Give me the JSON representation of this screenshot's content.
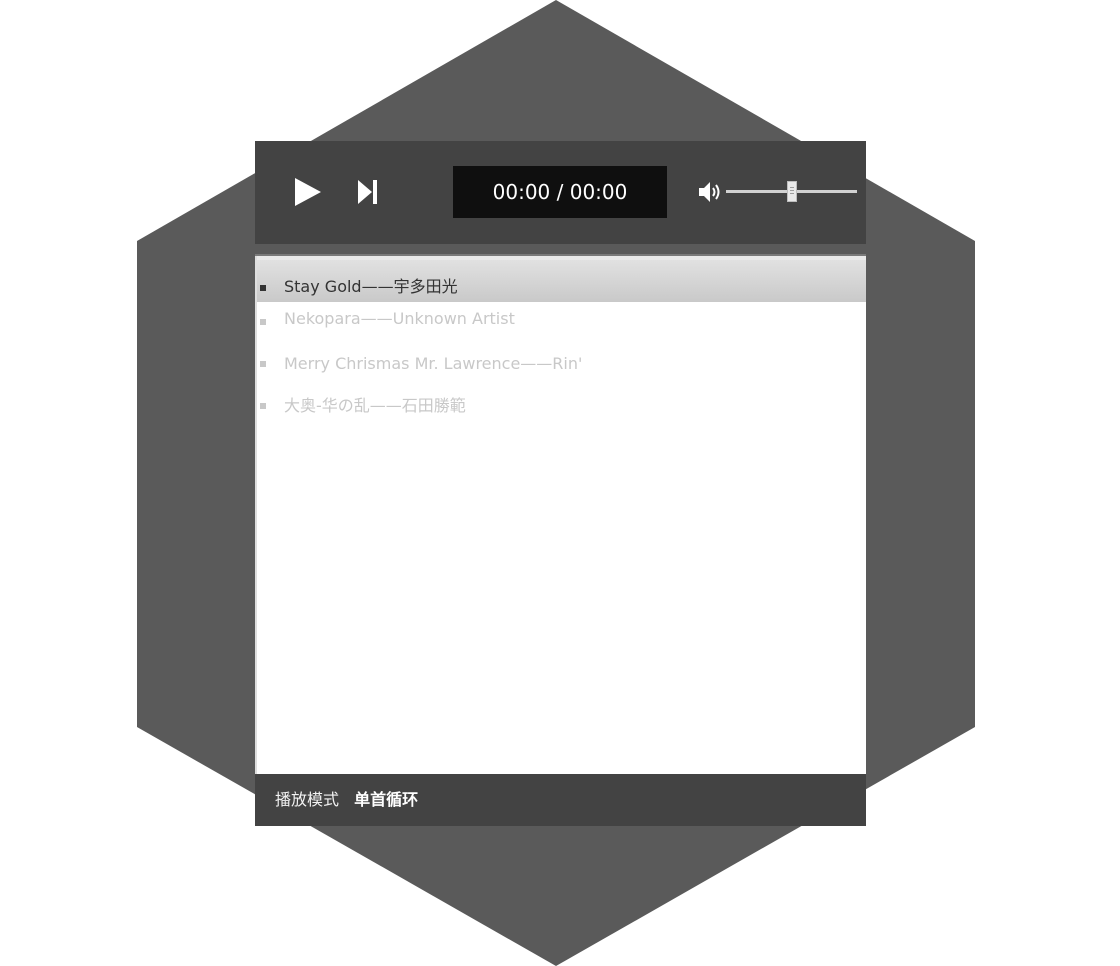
{
  "player": {
    "time_display": "00:00 / 00:00",
    "volume": 0.5,
    "icons": {
      "play": "play-icon",
      "next": "skip-next-icon",
      "volume": "speaker-volume-icon"
    }
  },
  "playlist": {
    "tracks": [
      {
        "label": "Stay Gold——宇多田光",
        "active": true
      },
      {
        "label": "Nekopara——Unknown Artist",
        "active": false
      },
      {
        "label": "Merry Chrismas Mr. Lawrence——Rin'",
        "active": false
      },
      {
        "label": "大奥-华の乱——石田勝範",
        "active": false
      }
    ]
  },
  "footer": {
    "mode_label": "播放模式",
    "mode_value": "单首循环"
  },
  "colors": {
    "background": "#ffffff",
    "hexagon": "#5a5a5a",
    "panel": "#434343",
    "time_box": "#0f0f0f",
    "active_track_text": "#333333",
    "inactive_track_text": "#c8c8c8"
  }
}
